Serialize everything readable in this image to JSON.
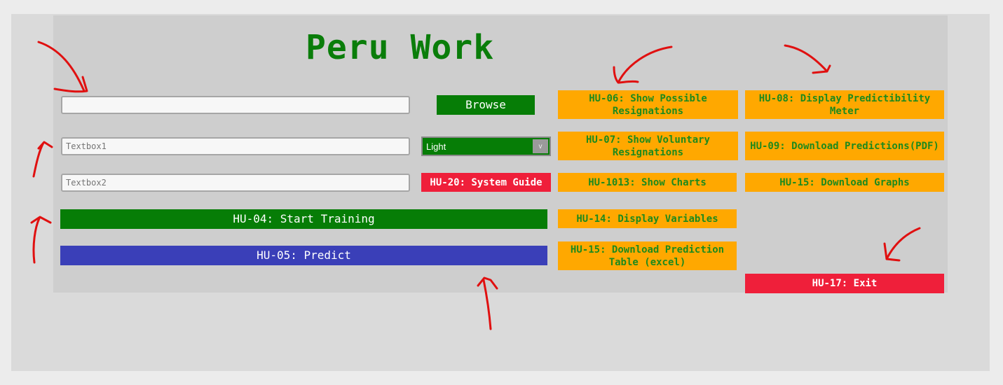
{
  "app": {
    "title": "Peru Work"
  },
  "inputs": {
    "file_path": {
      "value": "",
      "placeholder": ""
    },
    "textbox1": {
      "value": "",
      "placeholder": "Textbox1"
    },
    "textbox2": {
      "value": "",
      "placeholder": "Textbox2"
    }
  },
  "buttons": {
    "browse": "Browse",
    "system_guide": "HU-20: System Guide",
    "start_training": "HU-04: Start Training",
    "predict": "HU-05: Predict",
    "show_possible_resignations": "HU-06: Show Possible Resignations",
    "show_voluntary_resignations": "HU-07: Show Voluntary Resignations",
    "show_charts": "HU-1013: Show Charts",
    "display_variables": "HU-14: Display Variables",
    "download_prediction_table": "HU-15: Download Prediction Table (excel)",
    "display_predictibility_meter": "HU-08: Display Predictibility Meter",
    "download_predictions_pdf": "HU-09: Download Predictions(PDF)",
    "download_graphs": "HU-15: Download Graphs",
    "exit": "HU-17: Exit"
  },
  "theme_select": {
    "selected": "Light",
    "arrow": "v"
  },
  "colors": {
    "title_green": "#0a7d0a",
    "button_orange": "#ffa800",
    "button_red": "#ef1f3a",
    "button_green": "#067d06",
    "button_blue": "#3a3fb8",
    "annotation_red": "#e01010"
  },
  "annotations": {
    "type": "red-hand-drawn-arrows",
    "count": 8
  }
}
